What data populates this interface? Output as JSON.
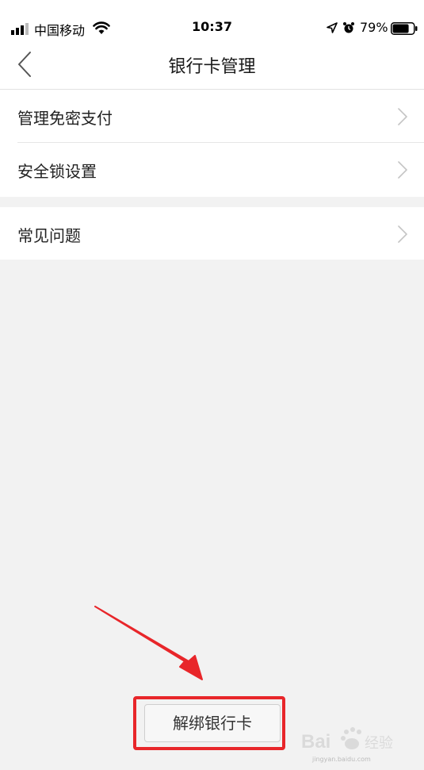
{
  "status_bar": {
    "carrier": "中国移动",
    "time": "10:37",
    "battery_percent": "79%",
    "battery_level": 0.79,
    "icons": [
      "signal-icon",
      "wifi-icon",
      "location-icon",
      "alarm-icon",
      "battery-icon"
    ]
  },
  "nav": {
    "title": "银行卡管理",
    "back_icon": "chevron-left-icon"
  },
  "settings": {
    "items": [
      {
        "label": "管理免密支付"
      },
      {
        "label": "安全锁设置"
      },
      {
        "label": "常见问题"
      }
    ]
  },
  "actions": {
    "unbind_label": "解绑银行卡"
  },
  "annotation": {
    "highlight_color": "#e8262a"
  },
  "watermark": {
    "brand": "Bai",
    "brand_suffix": "经验",
    "url": "jingyan.baidu.com"
  }
}
